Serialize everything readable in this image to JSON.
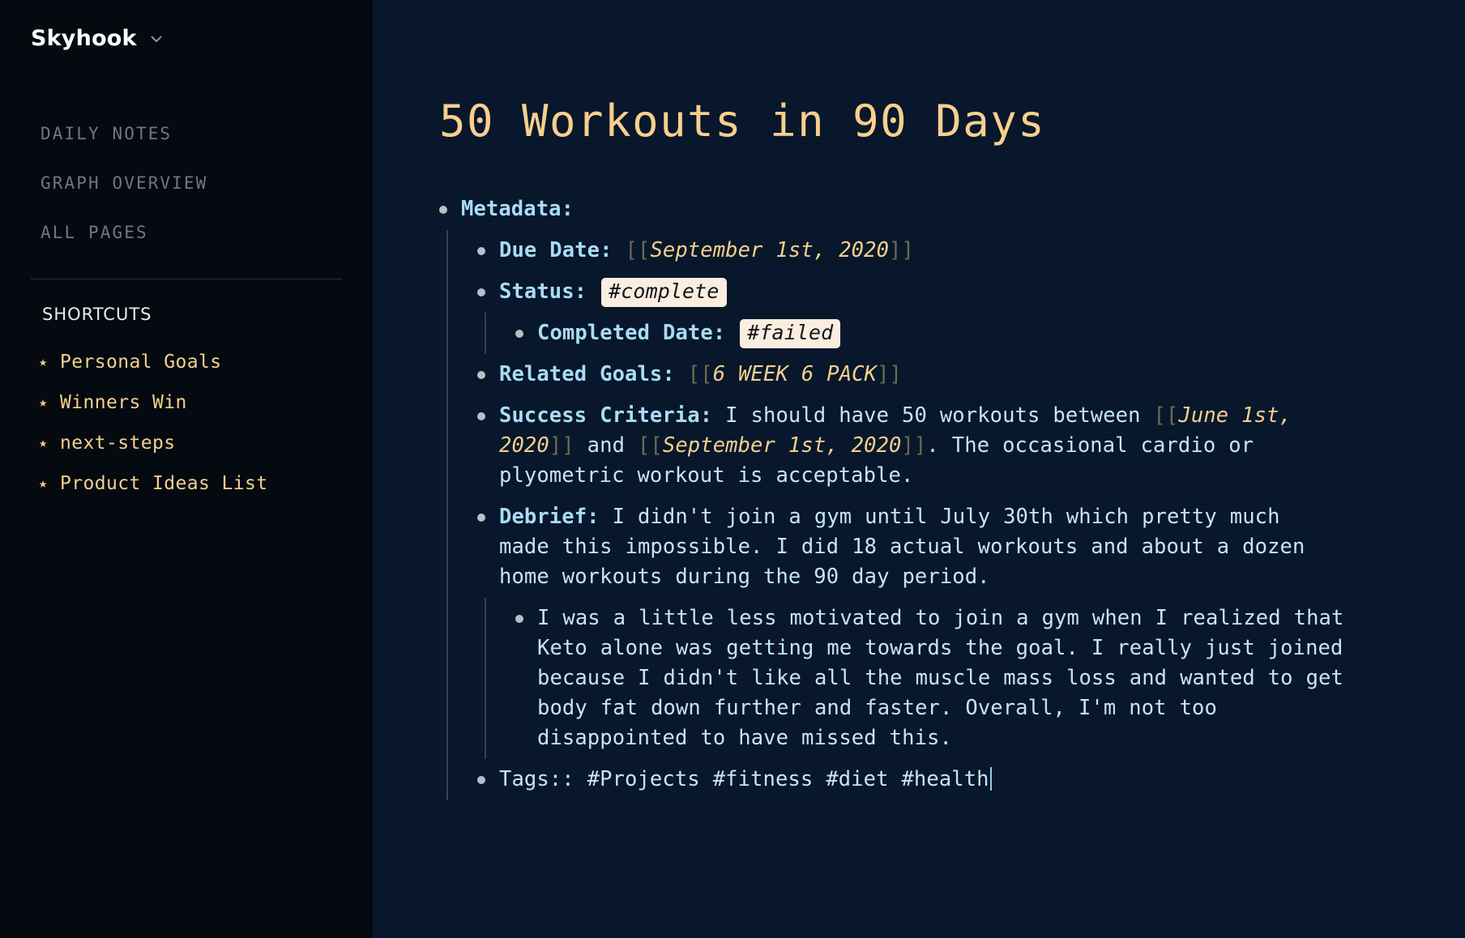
{
  "sidebar": {
    "brand": {
      "name": "Skyhook",
      "chevron_icon": "chevron-down-icon"
    },
    "nav": [
      {
        "label": "DAILY NOTES"
      },
      {
        "label": "GRAPH OVERVIEW"
      },
      {
        "label": "ALL PAGES"
      }
    ],
    "shortcuts_header": "SHORTCUTS",
    "shortcuts": [
      {
        "star_icon": "star-icon",
        "label": "Personal Goals"
      },
      {
        "star_icon": "star-icon",
        "label": "Winners Win"
      },
      {
        "star_icon": "star-icon",
        "label": "next-steps"
      },
      {
        "star_icon": "star-icon",
        "label": "Product Ideas List"
      }
    ]
  },
  "page": {
    "title": "50 Workouts in 90 Days",
    "metadata_label": "Metadata:",
    "due_date": {
      "label": "Due Date:",
      "open_bracket": "[[",
      "link": "September 1st, 2020",
      "close_bracket": "]]"
    },
    "status": {
      "label": "Status:",
      "tag": "#complete"
    },
    "completed_date": {
      "label": "Completed Date:",
      "tag": "#failed"
    },
    "related_goals": {
      "label": "Related Goals:",
      "open_bracket": "[[",
      "link": "6 WEEK 6 PACK",
      "close_bracket": "]]"
    },
    "success_criteria": {
      "label": "Success Criteria:",
      "text_1": " I should have 50 workouts between ",
      "open_bracket_1": "[[",
      "link_1": "June 1st, 2020",
      "close_bracket_1": "]]",
      "text_2": " and ",
      "open_bracket_2": "[[",
      "link_2": "September 1st, 2020",
      "close_bracket_2": "]]",
      "text_3": ". The occasional cardio or plyometric workout is acceptable."
    },
    "debrief": {
      "label": "Debrief:",
      "text": " I didn't join a gym until July 30th which pretty much made this impossible. I did 18 actual workouts and about a dozen home workouts during the 90 day period.",
      "child_text": "I was a little less motivated to join a gym when I realized that Keto alone was getting me towards the goal. I really just joined because I didn't like all the muscle mass loss and wanted to get body fat down further and faster. Overall, I'm not too disappointed to have missed this."
    },
    "tags_line": "Tags:: #Projects #fitness #diet #health"
  },
  "colors": {
    "sidebar_bg": "#040a10",
    "main_bg": "#08172b",
    "accent_amber": "#f5cf8e",
    "body_blue": "#c5e4f7",
    "label_blue": "#a8dcf5",
    "chip_bg": "#fbeddf",
    "chip_text": "#11151b",
    "guide_line": "#39414c"
  }
}
